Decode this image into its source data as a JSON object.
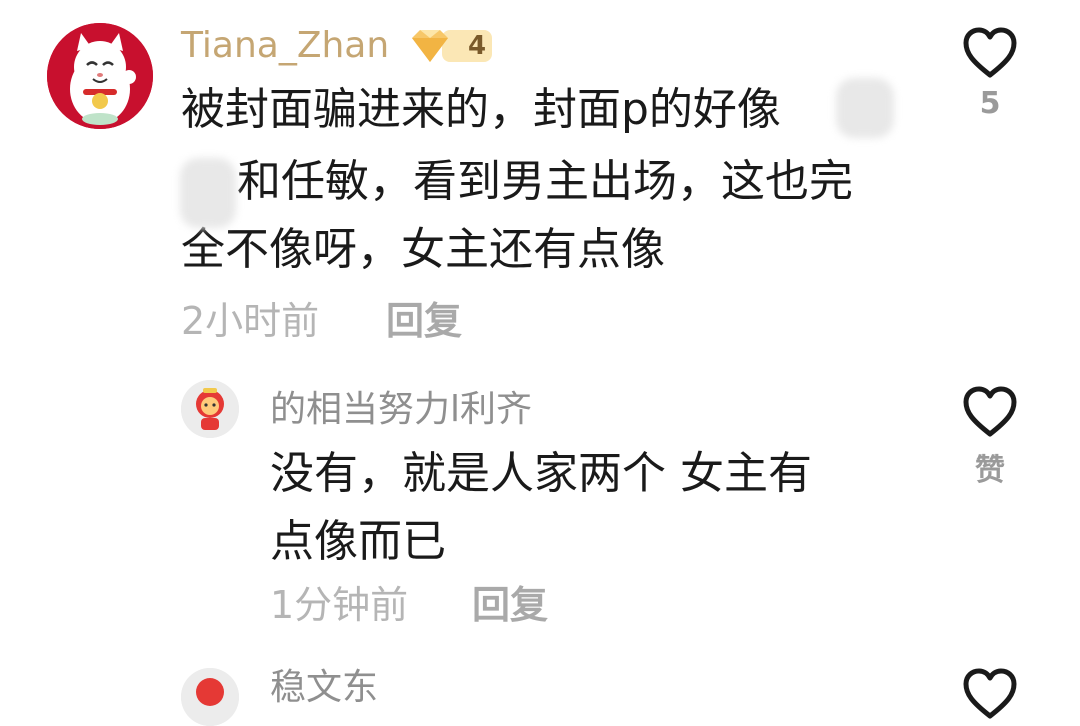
{
  "comments": [
    {
      "username": "Tiana_Zhan",
      "level": "4",
      "text_lines": [
        "被封面骗进来的，封面p的好像",
        "和任敏，看到男主出场，这也完",
        "全不像呀，女主还有点像"
      ],
      "time": "2小时前",
      "reply_label": "回复",
      "like_count": "5",
      "colors": {
        "username": "#c5a673"
      }
    },
    {
      "username": "的相当努力l利齐",
      "text_lines": [
        "没有，就是人家两个  女主有",
        "点像而已"
      ],
      "time": "1分钟前",
      "reply_label": "回复",
      "like_label": "赞"
    },
    {
      "username": "稳文东"
    }
  ]
}
